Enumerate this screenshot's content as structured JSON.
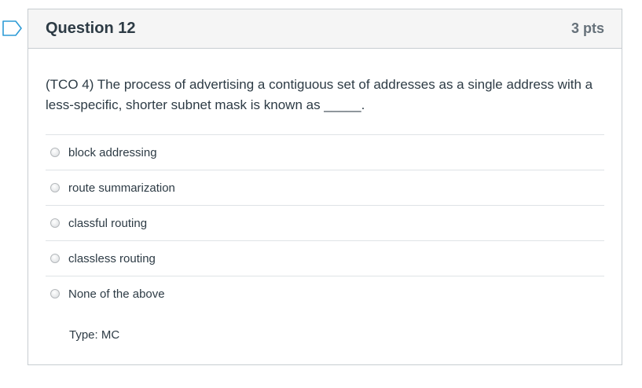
{
  "question": {
    "title": "Question 12",
    "points": "3 pts",
    "text": "(TCO 4) The process of advertising a contiguous set of addresses as a single address with a less-specific, shorter subnet mask is known as _____.",
    "answers": [
      {
        "label": "block addressing"
      },
      {
        "label": "route summarization"
      },
      {
        "label": "classful routing"
      },
      {
        "label": "classless routing"
      },
      {
        "label": "None of the above"
      }
    ],
    "type_note": "Type: MC"
  },
  "colors": {
    "flag": "#2d9bd6",
    "header_bg": "#f5f5f5",
    "border": "#c7cdd1",
    "text": "#2d3b45",
    "points": "#66717a"
  },
  "icons": {
    "flag": "bookmark-flag-icon"
  }
}
